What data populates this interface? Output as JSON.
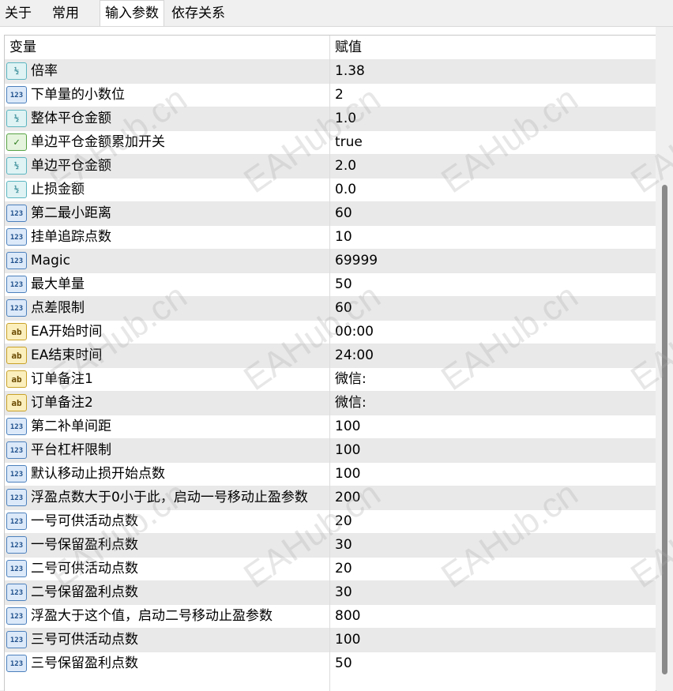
{
  "tabs": [
    {
      "label": "关于"
    },
    {
      "label": "常用"
    },
    {
      "label": "输入参数",
      "active": true
    },
    {
      "label": "依存关系"
    }
  ],
  "table": {
    "headers": {
      "variable": "变量",
      "value": "赋值"
    },
    "rows": [
      {
        "type": "double",
        "icon": "double-type-icon",
        "name": "倍率",
        "value": "1.38"
      },
      {
        "type": "int",
        "icon": "integer-type-icon",
        "name": "下单量的小数位",
        "value": "2"
      },
      {
        "type": "double",
        "icon": "double-type-icon",
        "name": "整体平仓金额",
        "value": "1.0"
      },
      {
        "type": "bool",
        "icon": "boolean-type-icon",
        "name": "单边平仓金额累加开关",
        "value": "true"
      },
      {
        "type": "double",
        "icon": "double-type-icon",
        "name": "单边平仓金额",
        "value": "2.0"
      },
      {
        "type": "double",
        "icon": "double-type-icon",
        "name": "止损金额",
        "value": "0.0"
      },
      {
        "type": "int",
        "icon": "integer-type-icon",
        "name": "第二最小距离",
        "value": "60"
      },
      {
        "type": "int",
        "icon": "integer-type-icon",
        "name": "挂单追踪点数",
        "value": "10"
      },
      {
        "type": "int",
        "icon": "integer-type-icon",
        "name": "Magic",
        "value": "69999"
      },
      {
        "type": "int",
        "icon": "integer-type-icon",
        "name": "最大单量",
        "value": "50"
      },
      {
        "type": "int",
        "icon": "integer-type-icon",
        "name": "点差限制",
        "value": "60"
      },
      {
        "type": "string",
        "icon": "string-type-icon",
        "name": "EA开始时间",
        "value": "00:00"
      },
      {
        "type": "string",
        "icon": "string-type-icon",
        "name": "EA结束时间",
        "value": "24:00"
      },
      {
        "type": "string",
        "icon": "string-type-icon",
        "name": "订单备注1",
        "value": "微信:"
      },
      {
        "type": "string",
        "icon": "string-type-icon",
        "name": "订单备注2",
        "value": "微信:"
      },
      {
        "type": "int",
        "icon": "integer-type-icon",
        "name": "第二补单间距",
        "value": "100"
      },
      {
        "type": "int",
        "icon": "integer-type-icon",
        "name": "平台杠杆限制",
        "value": "100"
      },
      {
        "type": "int",
        "icon": "integer-type-icon",
        "name": "默认移动止损开始点数",
        "value": "100"
      },
      {
        "type": "int",
        "icon": "integer-type-icon",
        "name": "浮盈点数大于0小于此，启动一号移动止盈参数",
        "value": "200"
      },
      {
        "type": "int",
        "icon": "integer-type-icon",
        "name": "一号可供活动点数",
        "value": "20"
      },
      {
        "type": "int",
        "icon": "integer-type-icon",
        "name": "一号保留盈利点数",
        "value": "30"
      },
      {
        "type": "int",
        "icon": "integer-type-icon",
        "name": "二号可供活动点数",
        "value": "20"
      },
      {
        "type": "int",
        "icon": "integer-type-icon",
        "name": "二号保留盈利点数",
        "value": "30"
      },
      {
        "type": "int",
        "icon": "integer-type-icon",
        "name": "浮盈大于这个值，启动二号移动止盈参数",
        "value": "800"
      },
      {
        "type": "int",
        "icon": "integer-type-icon",
        "name": "三号可供活动点数",
        "value": "100"
      },
      {
        "type": "int",
        "icon": "integer-type-icon",
        "name": "三号保留盈利点数",
        "value": "50"
      }
    ]
  },
  "icon_glyphs": {
    "int": "123",
    "double": "½",
    "string": "ab",
    "bool": "✓"
  },
  "watermark": "EAHub.cn"
}
